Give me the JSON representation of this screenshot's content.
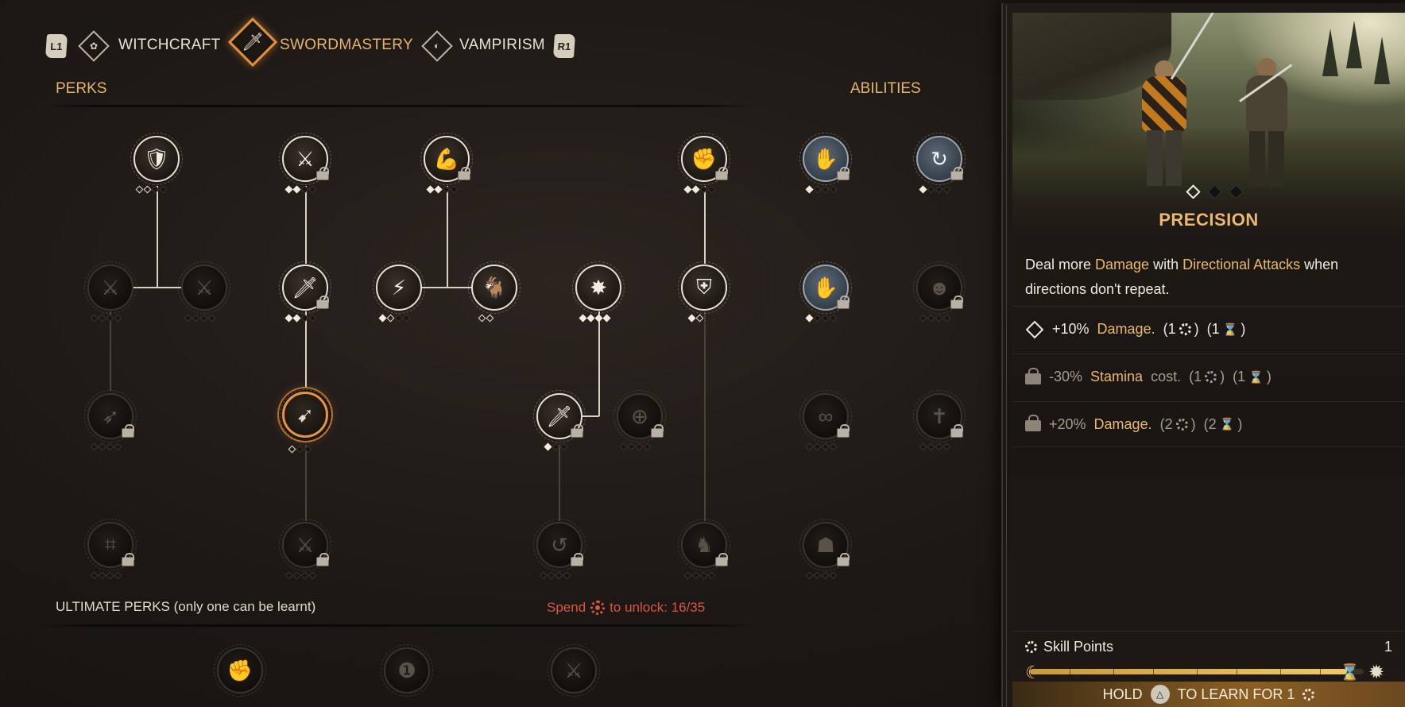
{
  "tabs": {
    "prev_button": "L1",
    "next_button": "R1",
    "items": [
      {
        "label": "WITCHCRAFT",
        "icon": "witchcraft-icon",
        "active": false
      },
      {
        "label": "SWORDMASTERY",
        "icon": "sword-icon",
        "active": true
      },
      {
        "label": "VAMPIRISM",
        "icon": "vampirism-icon",
        "active": false
      }
    ]
  },
  "sections": {
    "perks": "PERKS",
    "abilities": "ABILITIES",
    "ultimate": "ULTIMATE PERKS (only one can be learnt)",
    "unlock_prefix": "Spend",
    "unlock_suffix": "to unlock: 16/35"
  },
  "detail": {
    "title": "PRECISION",
    "description_parts": [
      "Deal more ",
      "Damage",
      " with ",
      "Directional Attacks",
      " when directions don't repeat."
    ],
    "tiers": [
      {
        "prefix": "+10%",
        "stat": "Damage.",
        "suffix": "",
        "cost_points": "(1",
        "cost_time": "(1",
        "state": "active"
      },
      {
        "prefix": "-30%",
        "stat": "Stamina",
        "suffix": "cost.",
        "cost_points": "(1",
        "cost_time": "(1",
        "state": "locked"
      },
      {
        "prefix": "+20%",
        "stat": "Damage.",
        "suffix": "",
        "cost_points": "(2",
        "cost_time": "(2",
        "state": "locked"
      }
    ],
    "carousel": {
      "count": 3,
      "active": 0
    }
  },
  "skill_points": {
    "label": "Skill Points",
    "value": "1",
    "progress": 0.95
  },
  "hold": {
    "prefix": "HOLD",
    "button": "△",
    "suffix": "TO LEARN FOR 1"
  },
  "colors": {
    "accent_gold": "#e4b56a",
    "accent_orange": "#e2913a",
    "warning_red": "#d8573f",
    "panel_bg": "#1d1814"
  }
}
